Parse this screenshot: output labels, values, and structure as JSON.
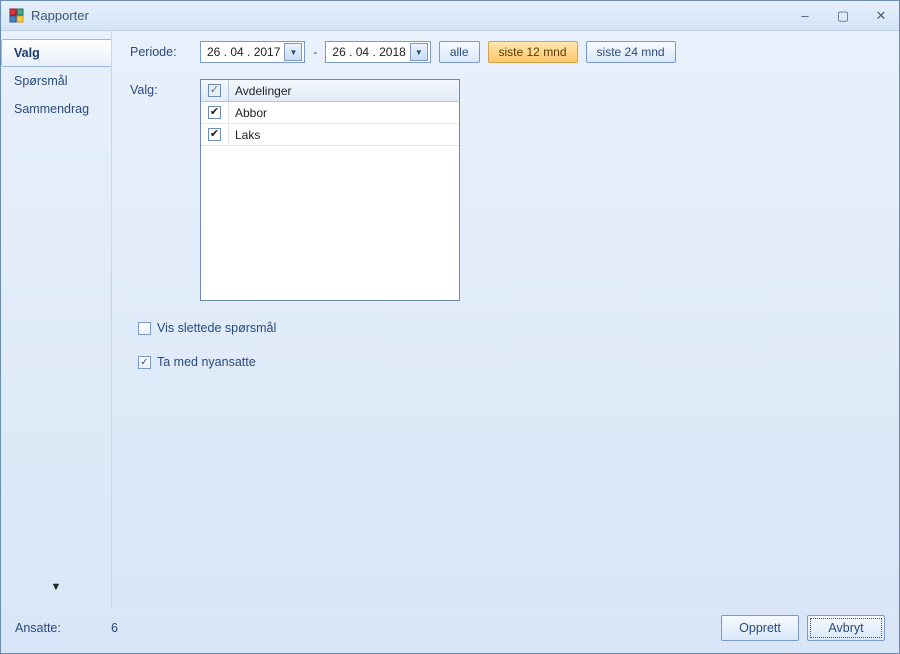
{
  "window": {
    "title": "Rapporter"
  },
  "sidebar": {
    "tabs": [
      {
        "label": "Valg",
        "active": true
      },
      {
        "label": "Spørsmål",
        "active": false
      },
      {
        "label": "Sammendrag",
        "active": false
      }
    ]
  },
  "labels": {
    "periode": "Periode:",
    "valg": "Valg:",
    "dash": "-"
  },
  "period": {
    "from": "26 . 04 . 2017",
    "to": "26 . 04 . 2018",
    "buttons": {
      "all": "alle",
      "last12": "siste 12 mnd",
      "last24": "siste 24 mnd"
    },
    "selected": "last12"
  },
  "grid": {
    "header": "Avdelinger",
    "rows": [
      {
        "checked": true,
        "name": "Abbor"
      },
      {
        "checked": true,
        "name": "Laks"
      }
    ]
  },
  "options": {
    "show_deleted": {
      "label": "Vis slettede spørsmål",
      "checked": false
    },
    "include_new": {
      "label": "Ta med nyansatte",
      "checked": true
    }
  },
  "footer": {
    "label": "Ansatte:",
    "value": "6",
    "create": "Opprett",
    "cancel": "Avbryt"
  }
}
